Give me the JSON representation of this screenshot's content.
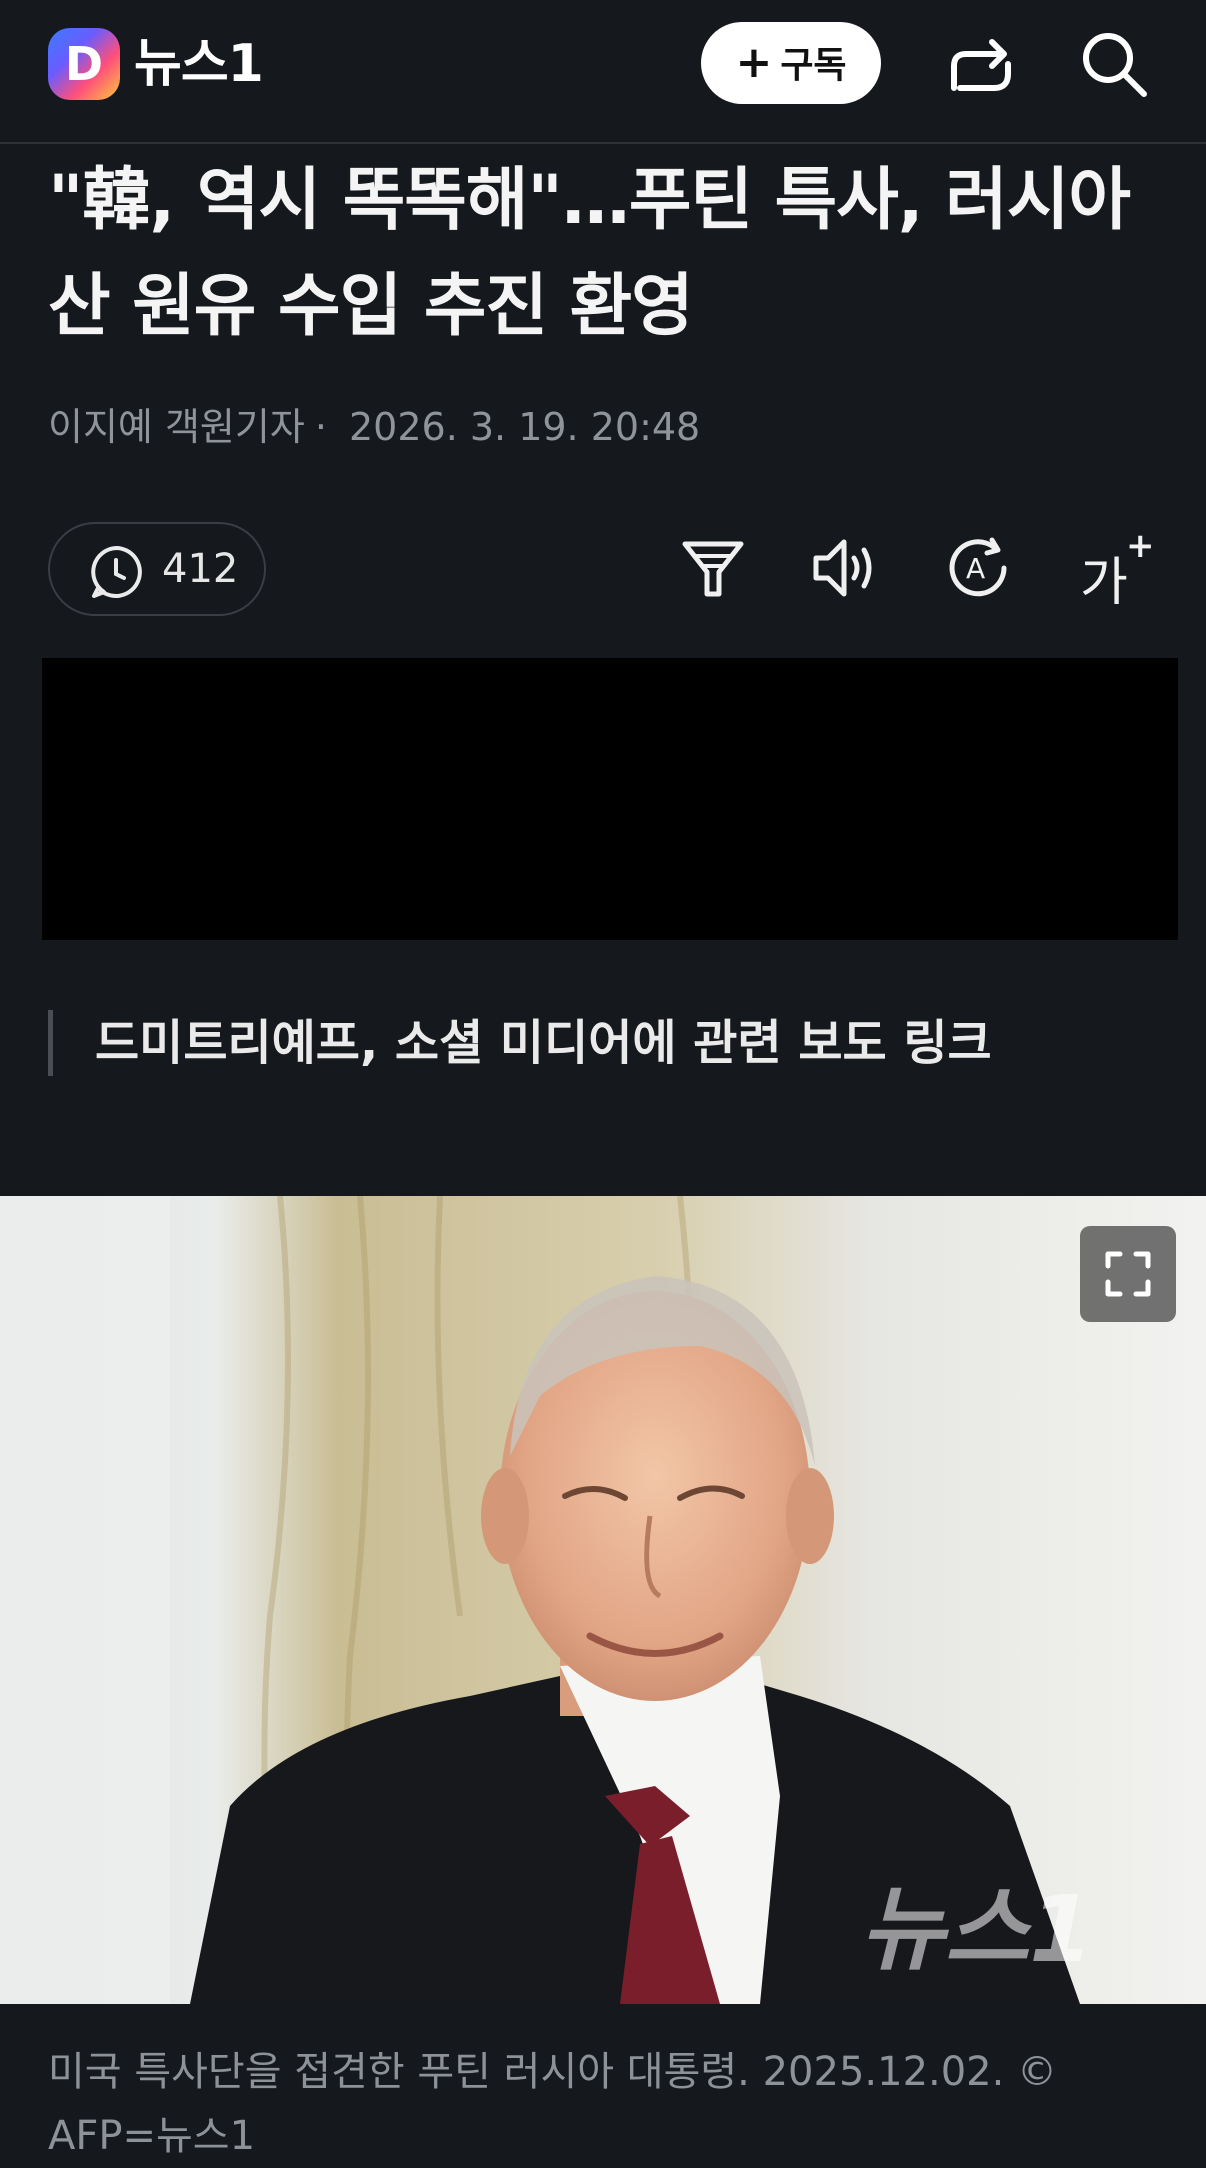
{
  "header": {
    "logo_letter": "D",
    "brand": "뉴스1",
    "subscribe_label": "구독",
    "icons": [
      "share-icon",
      "search-icon"
    ]
  },
  "article": {
    "headline": "\"韓, 역시 똑똑해\"…푸틴 특사, 러시아산 원유 수입 추진 환영",
    "reporter": "이지예 객원기자",
    "datetime": "2026. 3. 19. 20:48",
    "comment_count": "412",
    "tools": [
      "filter-icon",
      "audio-icon",
      "translate-icon",
      "font-size-icon"
    ],
    "font_tool_label": "가",
    "subheading": "드미트리예프, 소셜 미디어에 관련 보도 링크",
    "photo_watermark": "뉴스1",
    "caption": "미국 특사단을 접견한 푸틴 러시아 대통령. 2025.12.02. © AFP=뉴스1"
  },
  "colors": {
    "background": "#15181c",
    "text_primary": "#f4f4f4",
    "text_secondary": "#8f949a",
    "video_placeholder": "#000000",
    "tie": "#7a1e2c"
  }
}
